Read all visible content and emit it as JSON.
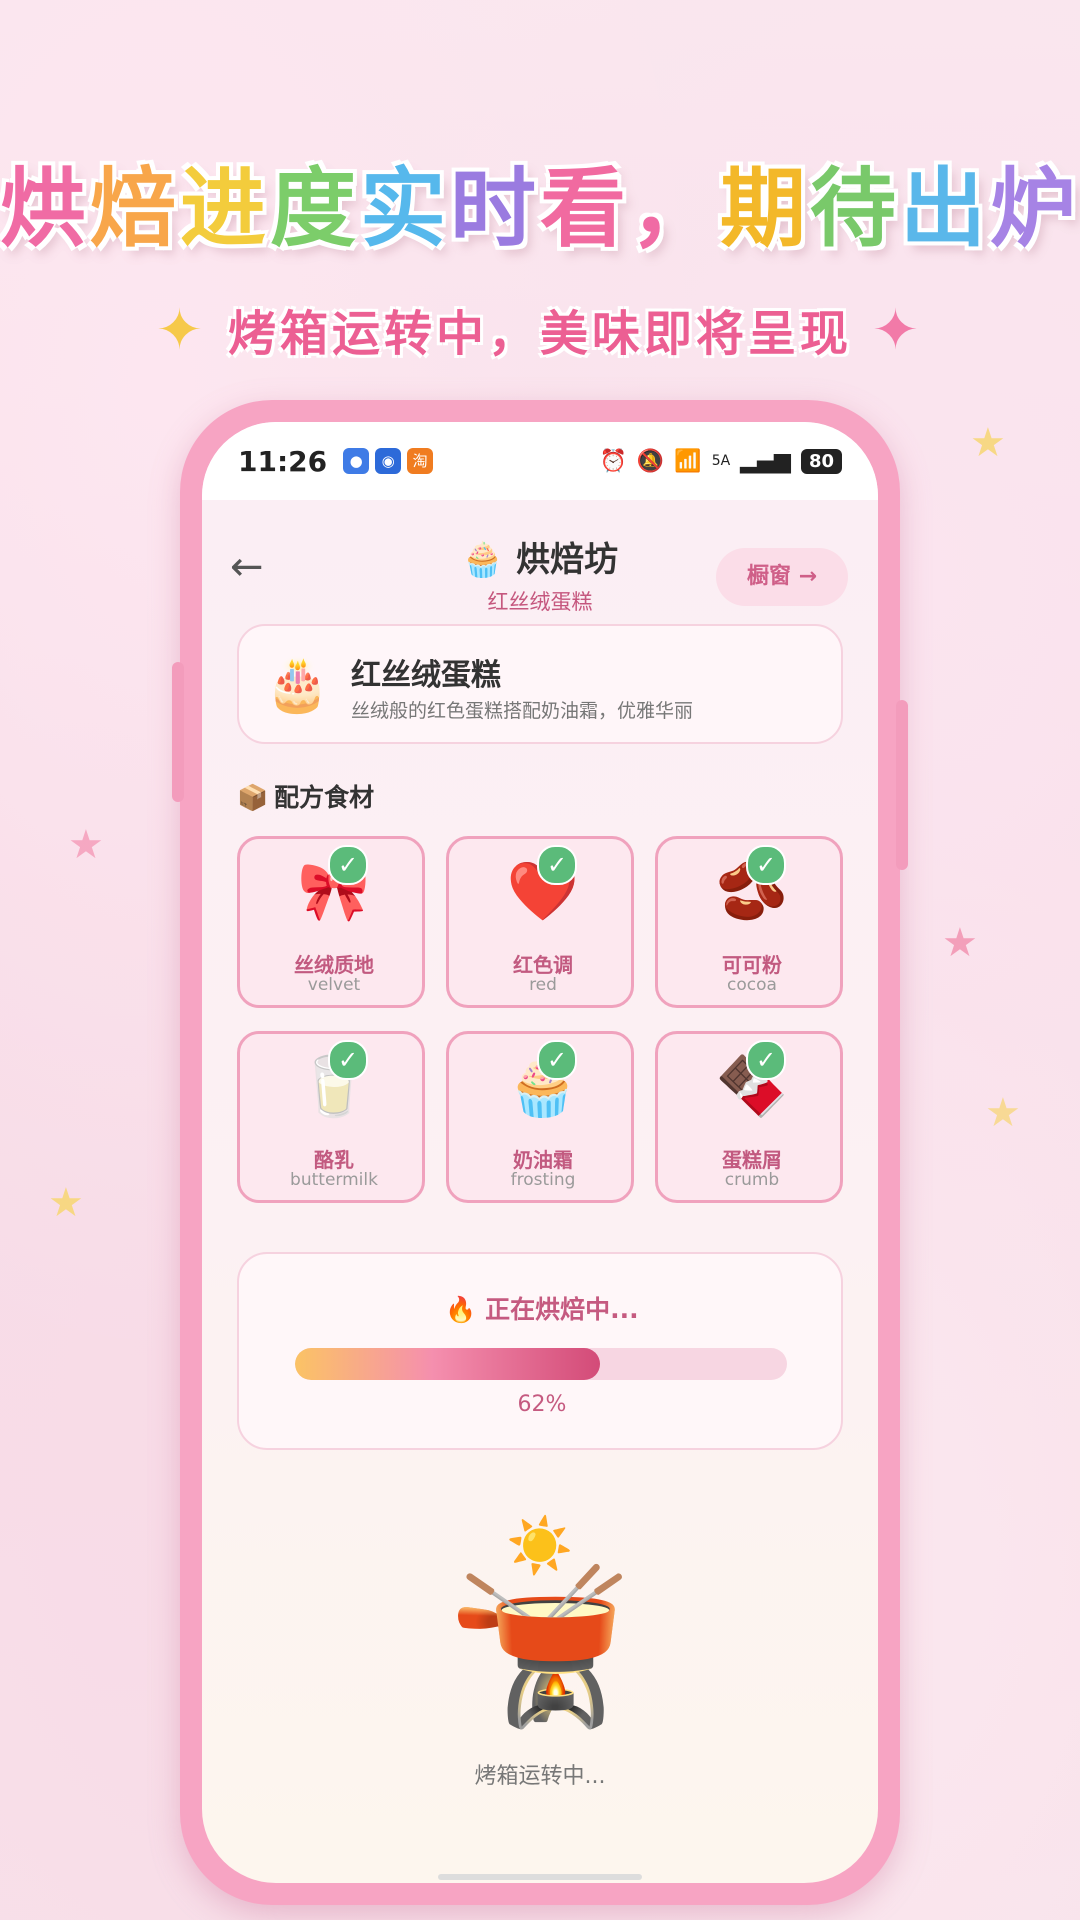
{
  "promo": {
    "headline_chars": [
      {
        "ch": "烘",
        "color": "#f06ba4"
      },
      {
        "ch": "焙",
        "color": "#f8a64a"
      },
      {
        "ch": "进",
        "color": "#f3cc3c"
      },
      {
        "ch": "度",
        "color": "#7ccd6a"
      },
      {
        "ch": "实",
        "color": "#56b8ec"
      },
      {
        "ch": "时",
        "color": "#9a7be0"
      },
      {
        "ch": "看",
        "color": "#f16aa0"
      },
      {
        "ch": "，",
        "color": "#f06ba4"
      },
      {
        "ch": "期",
        "color": "#f3b829"
      },
      {
        "ch": "待",
        "color": "#79c96a"
      },
      {
        "ch": "出",
        "color": "#5ab7ea"
      },
      {
        "ch": "炉",
        "color": "#a683e5"
      }
    ],
    "subline": "烤箱运转中，美味即将呈现"
  },
  "status_bar": {
    "time": "11:26",
    "battery": "80",
    "signal_label": "5A",
    "app_badge": "淘"
  },
  "nav": {
    "back_glyph": "←",
    "title": "🧁 烘焙坊",
    "subtitle": "红丝绒蛋糕",
    "action_label": "橱窗 →"
  },
  "cake": {
    "emoji": "🎂",
    "name": "红丝绒蛋糕",
    "description": "丝绒般的红色蛋糕搭配奶油霜，优雅华丽"
  },
  "ingredients_section": {
    "emoji": "📦",
    "title": "配方食材"
  },
  "ingredients": [
    {
      "emoji": "🎀",
      "cn": "丝绒质地",
      "en": "velvet",
      "checked": true
    },
    {
      "emoji": "❤️",
      "cn": "红色调",
      "en": "red",
      "checked": true
    },
    {
      "emoji": "🫘",
      "cn": "可可粉",
      "en": "cocoa",
      "checked": true
    },
    {
      "emoji": "🥛",
      "cn": "酪乳",
      "en": "buttermilk",
      "checked": true
    },
    {
      "emoji": "🧁",
      "cn": "奶油霜",
      "en": "frosting",
      "checked": true
    },
    {
      "emoji": "🍫",
      "cn": "蛋糕屑",
      "en": "crumb",
      "checked": true
    }
  ],
  "check_glyph": "✓",
  "progress": {
    "title": "🔥 正在烘焙中...",
    "value": 0.62,
    "label": "62%"
  },
  "oven": {
    "sun_emoji": "☀️",
    "pot_emoji": "🫕",
    "status": "烤箱运转中..."
  },
  "colors": {
    "accent_pink": "#ec5f93",
    "check_green": "#5bbb7a",
    "card_border": "#f0a2bd"
  }
}
